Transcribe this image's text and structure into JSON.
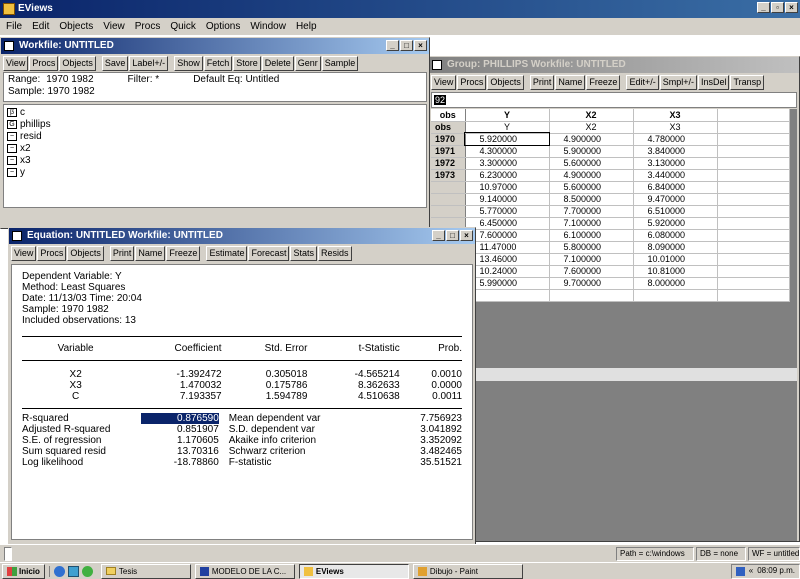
{
  "app": {
    "title": "EViews"
  },
  "menu": [
    "File",
    "Edit",
    "Objects",
    "View",
    "Procs",
    "Quick",
    "Options",
    "Window",
    "Help"
  ],
  "workfile": {
    "title": "Workfile: UNTITLED",
    "toolbar": [
      "View",
      "Procs",
      "Objects",
      "Save",
      "Label+/-",
      "Show",
      "Fetch",
      "Store",
      "Delete",
      "Genr",
      "Sample"
    ],
    "range_label": "Range:",
    "range_value": "1970 1982",
    "filter_label": "Filter: *",
    "default_eq": "Default Eq: Untitled",
    "sample_text": "Sample: 1970 1982",
    "objects": [
      {
        "icon": "coef-icon",
        "glyph": "β",
        "name": "c"
      },
      {
        "icon": "group-icon",
        "glyph": "G",
        "name": "phillips"
      },
      {
        "icon": "series-icon",
        "glyph": "~",
        "name": "resid"
      },
      {
        "icon": "series-icon",
        "glyph": "~",
        "name": "x2"
      },
      {
        "icon": "series-icon",
        "glyph": "~",
        "name": "x3"
      },
      {
        "icon": "series-icon",
        "glyph": "~",
        "name": "y"
      }
    ]
  },
  "group": {
    "title": "Group: PHILLIPS   Workfile: UNTITLED",
    "toolbar": [
      "View",
      "Procs",
      "Objects",
      "Print",
      "Name",
      "Freeze",
      "Edit+/-",
      "Smpl+/-",
      "InsDel",
      "Transp"
    ],
    "edit_value": "92",
    "columns": [
      "obs",
      "Y",
      "X2",
      "X3"
    ],
    "subheader": [
      "obs",
      "Y",
      "X2",
      "X3"
    ],
    "rows": [
      {
        "obs": "1970",
        "y": "5.920000",
        "x2": "4.900000",
        "x3": "4.780000"
      },
      {
        "obs": "1971",
        "y": "4.300000",
        "x2": "5.900000",
        "x3": "3.840000"
      },
      {
        "obs": "1972",
        "y": "3.300000",
        "x2": "5.600000",
        "x3": "3.130000"
      },
      {
        "obs": "1973",
        "y": "6.230000",
        "x2": "4.900000",
        "x3": "3.440000"
      },
      {
        "obs": "",
        "y": "10.97000",
        "x2": "5.600000",
        "x3": "6.840000"
      },
      {
        "obs": "",
        "y": "9.140000",
        "x2": "8.500000",
        "x3": "9.470000"
      },
      {
        "obs": "",
        "y": "5.770000",
        "x2": "7.700000",
        "x3": "6.510000"
      },
      {
        "obs": "",
        "y": "6.450000",
        "x2": "7.100000",
        "x3": "5.920000"
      },
      {
        "obs": "",
        "y": "7.600000",
        "x2": "6.100000",
        "x3": "6.080000"
      },
      {
        "obs": "",
        "y": "11.47000",
        "x2": "5.800000",
        "x3": "8.090000"
      },
      {
        "obs": "",
        "y": "13.46000",
        "x2": "7.100000",
        "x3": "10.01000"
      },
      {
        "obs": "",
        "y": "10.24000",
        "x2": "7.600000",
        "x3": "10.81000"
      },
      {
        "obs": "",
        "y": "5.990000",
        "x2": "9.700000",
        "x3": "8.000000"
      }
    ]
  },
  "equation": {
    "title": "Equation: UNTITLED   Workfile: UNTITLED",
    "toolbar": [
      "View",
      "Procs",
      "Objects",
      "Print",
      "Name",
      "Freeze",
      "Estimate",
      "Forecast",
      "Stats",
      "Resids"
    ],
    "header_lines": [
      "Dependent Variable: Y",
      "Method: Least Squares",
      "Date: 11/13/03   Time: 20:04",
      "Sample: 1970 1982",
      "Included observations: 13"
    ],
    "coef_headers": [
      "Variable",
      "Coefficient",
      "Std. Error",
      "t-Statistic",
      "Prob."
    ],
    "coef_rows": [
      [
        "X2",
        "-1.392472",
        "0.305018",
        "-4.565214",
        "0.0010"
      ],
      [
        "X3",
        "1.470032",
        "0.175786",
        "8.362633",
        "0.0000"
      ],
      [
        "C",
        "7.193357",
        "1.594789",
        "4.510638",
        "0.0011"
      ]
    ],
    "stats_rows": [
      [
        "R-squared",
        "0.876590",
        "Mean dependent var",
        "7.756923"
      ],
      [
        "Adjusted R-squared",
        "0.851907",
        "S.D. dependent var",
        "3.041892"
      ],
      [
        "S.E. of regression",
        "1.170605",
        "Akaike info criterion",
        "3.352092"
      ],
      [
        "Sum squared resid",
        "13.70316",
        "Schwarz criterion",
        "3.482465"
      ],
      [
        "Log likelihood",
        "-18.78860",
        "F-statistic",
        "35.51521"
      ]
    ]
  },
  "statusbar": [
    "Path = c:\\windows",
    "DB = none",
    "WF = untitled"
  ],
  "taskbar": {
    "start": "Inicio",
    "tasks": [
      {
        "label": "Tesis",
        "active": false
      },
      {
        "label": "MODELO DE LA C...",
        "active": false
      },
      {
        "label": "EViews",
        "active": true
      },
      {
        "label": "Dibujo - Paint",
        "active": false
      }
    ],
    "clock": "08:09 p.m."
  }
}
